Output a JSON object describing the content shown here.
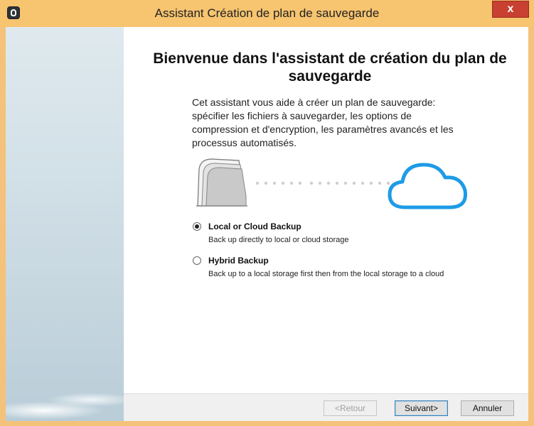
{
  "window": {
    "title": "Assistant Création de plan de sauvegarde",
    "close_label": "x"
  },
  "main": {
    "heading": "Bienvenue dans l'assistant de création du plan de sauvegarde",
    "description": "Cet assistant vous aide à créer un plan de sauvegarde: spécifier les fichiers à sauvegarder, les options de compression et d'encryption, les paramètres avancés et les processus automatisés.",
    "options": [
      {
        "label": "Local or Cloud Backup",
        "description": "Back up directly to local or cloud storage",
        "selected": true
      },
      {
        "label": "Hybrid Backup",
        "description": "Back up to a local storage first then from the local storage to a cloud",
        "selected": false
      }
    ]
  },
  "footer": {
    "back_label": "<Retour",
    "next_label": "Suivant>",
    "cancel_label": "Annuler"
  },
  "colors": {
    "title_bar": "#f7c46f",
    "close_button": "#c84031",
    "cloud_blue": "#1e9be6"
  },
  "icons": [
    "app-logo-icon",
    "document-stack-icon",
    "cloud-icon",
    "close-icon"
  ]
}
